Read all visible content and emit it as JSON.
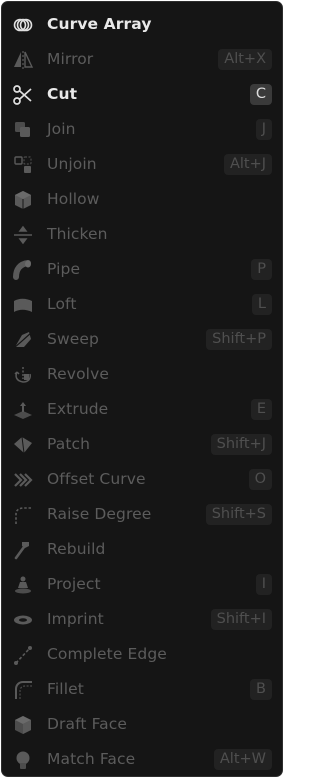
{
  "menu": {
    "items": [
      {
        "label": "Curve Array",
        "shortcut": "",
        "icon": "curve-array-icon",
        "enabled": true
      },
      {
        "label": "Mirror",
        "shortcut": "Alt+X",
        "icon": "mirror-icon",
        "enabled": false
      },
      {
        "label": "Cut",
        "shortcut": "C",
        "icon": "scissors-icon",
        "enabled": true
      },
      {
        "label": "Join",
        "shortcut": "J",
        "icon": "join-icon",
        "enabled": false
      },
      {
        "label": "Unjoin",
        "shortcut": "Alt+J",
        "icon": "unjoin-icon",
        "enabled": false
      },
      {
        "label": "Hollow",
        "shortcut": "",
        "icon": "hollow-icon",
        "enabled": false
      },
      {
        "label": "Thicken",
        "shortcut": "",
        "icon": "thicken-icon",
        "enabled": false
      },
      {
        "label": "Pipe",
        "shortcut": "P",
        "icon": "pipe-icon",
        "enabled": false
      },
      {
        "label": "Loft",
        "shortcut": "L",
        "icon": "loft-icon",
        "enabled": false
      },
      {
        "label": "Sweep",
        "shortcut": "Shift+P",
        "icon": "sweep-icon",
        "enabled": false
      },
      {
        "label": "Revolve",
        "shortcut": "",
        "icon": "revolve-icon",
        "enabled": false
      },
      {
        "label": "Extrude",
        "shortcut": "E",
        "icon": "extrude-icon",
        "enabled": false
      },
      {
        "label": "Patch",
        "shortcut": "Shift+J",
        "icon": "patch-icon",
        "enabled": false
      },
      {
        "label": "Offset Curve",
        "shortcut": "O",
        "icon": "offset-curve-icon",
        "enabled": false
      },
      {
        "label": "Raise Degree",
        "shortcut": "Shift+S",
        "icon": "raise-degree-icon",
        "enabled": false
      },
      {
        "label": "Rebuild",
        "shortcut": "",
        "icon": "rebuild-icon",
        "enabled": false
      },
      {
        "label": "Project",
        "shortcut": "I",
        "icon": "project-icon",
        "enabled": false
      },
      {
        "label": "Imprint",
        "shortcut": "Shift+I",
        "icon": "imprint-icon",
        "enabled": false
      },
      {
        "label": "Complete Edge",
        "shortcut": "",
        "icon": "complete-edge-icon",
        "enabled": false
      },
      {
        "label": "Fillet",
        "shortcut": "B",
        "icon": "fillet-icon",
        "enabled": false
      },
      {
        "label": "Draft Face",
        "shortcut": "",
        "icon": "draft-face-icon",
        "enabled": false
      },
      {
        "label": "Match Face",
        "shortcut": "Alt+W",
        "icon": "match-face-icon",
        "enabled": false
      }
    ]
  },
  "colors": {
    "background": "#151515",
    "enabled_text": "#e9e9e9",
    "disabled_text": "#5c5c5c"
  }
}
